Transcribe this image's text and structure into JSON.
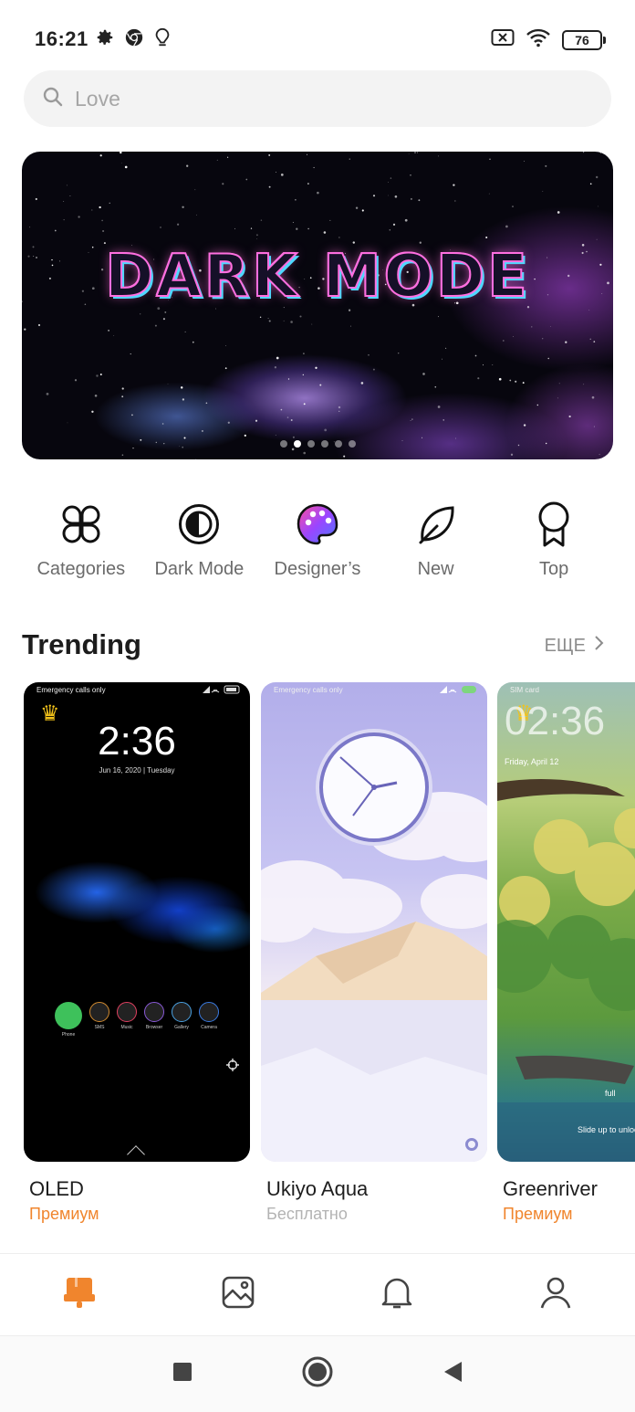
{
  "status_bar": {
    "time": "16:21",
    "battery": "76"
  },
  "search": {
    "placeholder": "Love"
  },
  "banner": {
    "title": "DARK MODE",
    "slide_count": 6,
    "active_slide": 1
  },
  "shortcuts": [
    {
      "label": "Categories",
      "icon": "categories-icon"
    },
    {
      "label": "Dark Mode",
      "icon": "dark-mode-icon"
    },
    {
      "label": "Designer’s",
      "icon": "palette-icon"
    },
    {
      "label": "New",
      "icon": "leaf-icon"
    },
    {
      "label": "Top",
      "icon": "award-icon"
    }
  ],
  "trending": {
    "title": "Trending",
    "more": "ЕЩЕ",
    "items": [
      {
        "name": "OLED",
        "price": "Премиум",
        "premium": true,
        "preview": {
          "status": "Emergency calls only",
          "time": "2:36",
          "date": "Jun 16, 2020 | Tuesday",
          "apps": [
            "Phone",
            "SMS",
            "Music",
            "Browser",
            "Gallery",
            "Camera"
          ]
        }
      },
      {
        "name": "Ukiyo Aqua",
        "price": "Бесплатно",
        "premium": false,
        "preview": {
          "status": "Emergency calls only"
        }
      },
      {
        "name": "Greenriver",
        "price": "Премиум",
        "premium": true,
        "preview": {
          "status": "SIM card",
          "time": "02:36",
          "date": "Friday, April 12",
          "text1": "full",
          "text2": "Slide up to unlock"
        }
      }
    ]
  },
  "bottom_nav": [
    {
      "icon": "themes-icon",
      "active": true
    },
    {
      "icon": "wallpaper-icon",
      "active": false
    },
    {
      "icon": "notifications-icon",
      "active": false
    },
    {
      "icon": "profile-icon",
      "active": false
    }
  ],
  "colors": {
    "accent": "#F0852D",
    "text_secondary": "#6B6B6B",
    "search_bg": "#F3F3F3"
  }
}
